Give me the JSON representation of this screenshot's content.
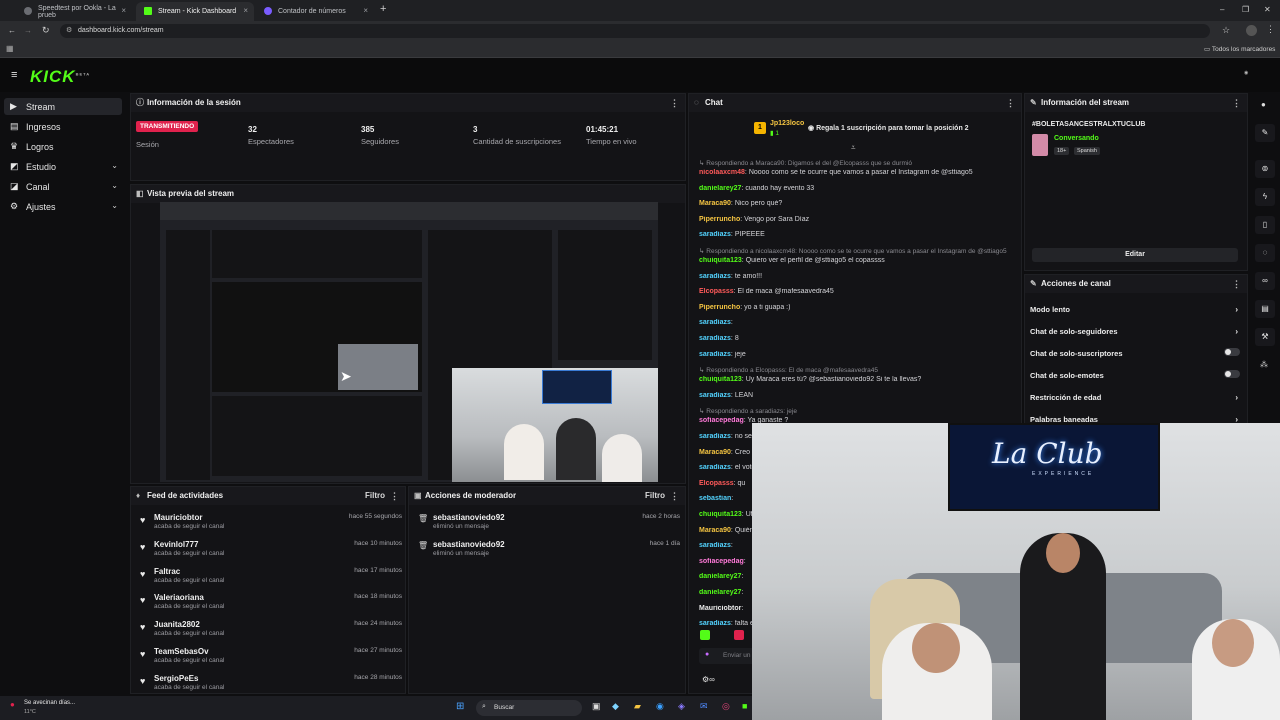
{
  "browser": {
    "tabs": [
      {
        "label": "Speedtest por Ookla - La prueb",
        "close": "×"
      },
      {
        "label": "Stream - Kick Dashboard",
        "close": "×"
      },
      {
        "label": "Contador de números",
        "close": "×"
      }
    ],
    "new_tab": "+",
    "url": "dashboard.kick.com/stream",
    "bookmarks_label": "Todos los marcadores",
    "win_min": "–",
    "win_max": "❐",
    "win_close": "✕"
  },
  "app": {
    "logo": "KICK",
    "logo_badge": "BETA"
  },
  "sidebar": {
    "items": [
      {
        "label": "Stream",
        "icon": "play-icon"
      },
      {
        "label": "Ingresos",
        "icon": "money-icon"
      },
      {
        "label": "Logros",
        "icon": "trophy-icon"
      },
      {
        "label": "Estudio",
        "icon": "studio-icon"
      },
      {
        "label": "Canal",
        "icon": "channel-icon"
      },
      {
        "label": "Ajustes",
        "icon": "gear-icon"
      }
    ]
  },
  "session": {
    "title": "Información de la sesión",
    "badge": "TRANSMITIENDO",
    "badge_label": "Sesión",
    "stats": [
      {
        "value": "32",
        "label": "Espectadores"
      },
      {
        "value": "385",
        "label": "Seguidores"
      },
      {
        "value": "3",
        "label": "Cantidad de suscripciones"
      },
      {
        "value": "01:45:21",
        "label": "Tiempo en vivo"
      }
    ]
  },
  "preview": {
    "title": "Vista previa del stream"
  },
  "feed": {
    "title": "Feed de actividades",
    "filter": "Filtro",
    "items": [
      {
        "name": "Mauriciobtor",
        "sub": "acaba de seguir el canal",
        "time": "hace 55 segundos"
      },
      {
        "name": "Kevinlol777",
        "sub": "acaba de seguir el canal",
        "time": "hace 10 minutos"
      },
      {
        "name": "Faltrac",
        "sub": "acaba de seguir el canal",
        "time": "hace 17 minutos"
      },
      {
        "name": "Valeriaoriana",
        "sub": "acaba de seguir el canal",
        "time": "hace 18 minutos"
      },
      {
        "name": "Juanita2802",
        "sub": "acaba de seguir el canal",
        "time": "hace 24 minutos"
      },
      {
        "name": "TeamSebasOv",
        "sub": "acaba de seguir el canal",
        "time": "hace 27 minutos"
      },
      {
        "name": "SergioPeEs",
        "sub": "acaba de seguir el canal",
        "time": "hace 28 minutos"
      }
    ]
  },
  "moderator": {
    "title": "Acciones de moderador",
    "filter": "Filtro",
    "items": [
      {
        "name": "sebastianoviedo92",
        "sub": "eliminó un mensaje",
        "time": "hace 2 horas"
      },
      {
        "name": "sebastianoviedo92",
        "sub": "eliminó un mensaje",
        "time": "hace 1 día"
      }
    ]
  },
  "chat": {
    "title": "Chat",
    "pinned_user": "Jp123loco",
    "pinned_count": "1",
    "pinned_rank": "1",
    "pinned_text": "Regala 1 suscripción para tomar la posición 2",
    "messages": [
      {
        "reply": "Respondiendo a Maraca90: Digamos el del @Elcopasss que se durmió"
      },
      {
        "user": "nicolaaxcm48",
        "color": "#ff5a5a",
        "text": "Noooo como se te ocurre que vamos a pasar el Instagram de @sttiago5"
      },
      {
        "user": "danielarey27",
        "color": "#53fc18",
        "text": "cuando hay evento 33"
      },
      {
        "user": "Maraca90",
        "color": "#f5c542",
        "text": "Nico pero qué?"
      },
      {
        "user": "Piperruncho",
        "color": "#f5c542",
        "text": "Vengo por Sara Díaz"
      },
      {
        "user": "saradiazs",
        "color": "#53d3ff",
        "text": "PIPEEEE"
      },
      {
        "reply": "Respondiendo a nicolaaxcm48: Noooo como se te ocurre que vamos a pasar el Instagram de @sttiago5"
      },
      {
        "user": "chuiquita123",
        "color": "#53fc18",
        "text": "Quiero ver el perfil de @sttiago5 el copassss"
      },
      {
        "user": "saradiazs",
        "color": "#53d3ff",
        "text": "te amo!!!"
      },
      {
        "user": "Elcopasss",
        "color": "#ff5a5a",
        "text": "El de maca @mafesaavedra45"
      },
      {
        "user": "Piperruncho",
        "color": "#f5c542",
        "text": "yo a ti guapa :)"
      },
      {
        "user": "saradiazs",
        "color": "#53d3ff",
        "text": ""
      },
      {
        "user": "saradiazs",
        "color": "#53d3ff",
        "text": "8"
      },
      {
        "user": "saradiazs",
        "color": "#53d3ff",
        "text": "jeje"
      },
      {
        "reply": "Respondiendo a Elcopasss: El de maca @mafesaavedra45"
      },
      {
        "user": "chuiquita123",
        "color": "#53fc18",
        "text": "Uy Maraca eres tú? @sebastianoviedo92 Si te la llevas?"
      },
      {
        "user": "saradiazs",
        "color": "#53d3ff",
        "text": "LEAN"
      },
      {
        "reply": "Respondiendo a saradiazs: jeje"
      },
      {
        "user": "sofiacepedag",
        "color": "#ff7ad9",
        "text": "Ya ganaste ?"
      },
      {
        "user": "saradiazs",
        "color": "#53d3ff",
        "text": "no se"
      },
      {
        "user": "Maraca90",
        "color": "#f5c542",
        "text": "Creo"
      },
      {
        "user": "saradiazs",
        "color": "#53d3ff",
        "text": "el voto"
      },
      {
        "user": "Elcopasss",
        "color": "#ff5a5a",
        "text": "qu"
      },
      {
        "user": "sebastian",
        "color": "#53d3ff",
        "text": ""
      },
      {
        "user": "chuiquita123",
        "color": "#53fc18",
        "text": "Uff"
      },
      {
        "user": "Maraca90",
        "color": "#f5c542",
        "text": "Quién"
      },
      {
        "user": "saradiazs",
        "color": "#53d3ff",
        "text": ""
      },
      {
        "user": "sofiacepedag",
        "color": "#ff7ad9",
        "text": ""
      },
      {
        "user": "danielarey27",
        "color": "#53fc18",
        "text": ""
      },
      {
        "user": "danielarey27",
        "color": "#53fc18",
        "text": ""
      },
      {
        "user": "Mauriciobtor",
        "color": "#ececec",
        "text": ""
      },
      {
        "user": "saradiazs",
        "color": "#53d3ff",
        "text": "falta e"
      }
    ],
    "input_placeholder": "Enviar un"
  },
  "stream_info": {
    "title": "Información del stream",
    "hashtag": "#BOLETASANCESTRALXTUCLUB",
    "category": "Conversando",
    "tags": [
      "18+",
      "Spanish"
    ],
    "edit_label": "Editar"
  },
  "channel_actions": {
    "title": "Acciones de canal",
    "items": [
      {
        "label": "Modo lento",
        "type": "arrow"
      },
      {
        "label": "Chat de solo-seguidores",
        "type": "arrow"
      },
      {
        "label": "Chat de solo-suscriptores",
        "type": "toggle"
      },
      {
        "label": "Chat de solo-emotes",
        "type": "toggle"
      },
      {
        "label": "Restricción de edad",
        "type": "arrow"
      },
      {
        "label": "Palabras baneadas",
        "type": "arrow"
      }
    ]
  },
  "taskbar": {
    "weather": "Se avecinan días...",
    "temp": "11°C",
    "search": "Buscar"
  },
  "webcam": {
    "sign": "La Club",
    "sign_sub": "EXPERIENCE"
  }
}
